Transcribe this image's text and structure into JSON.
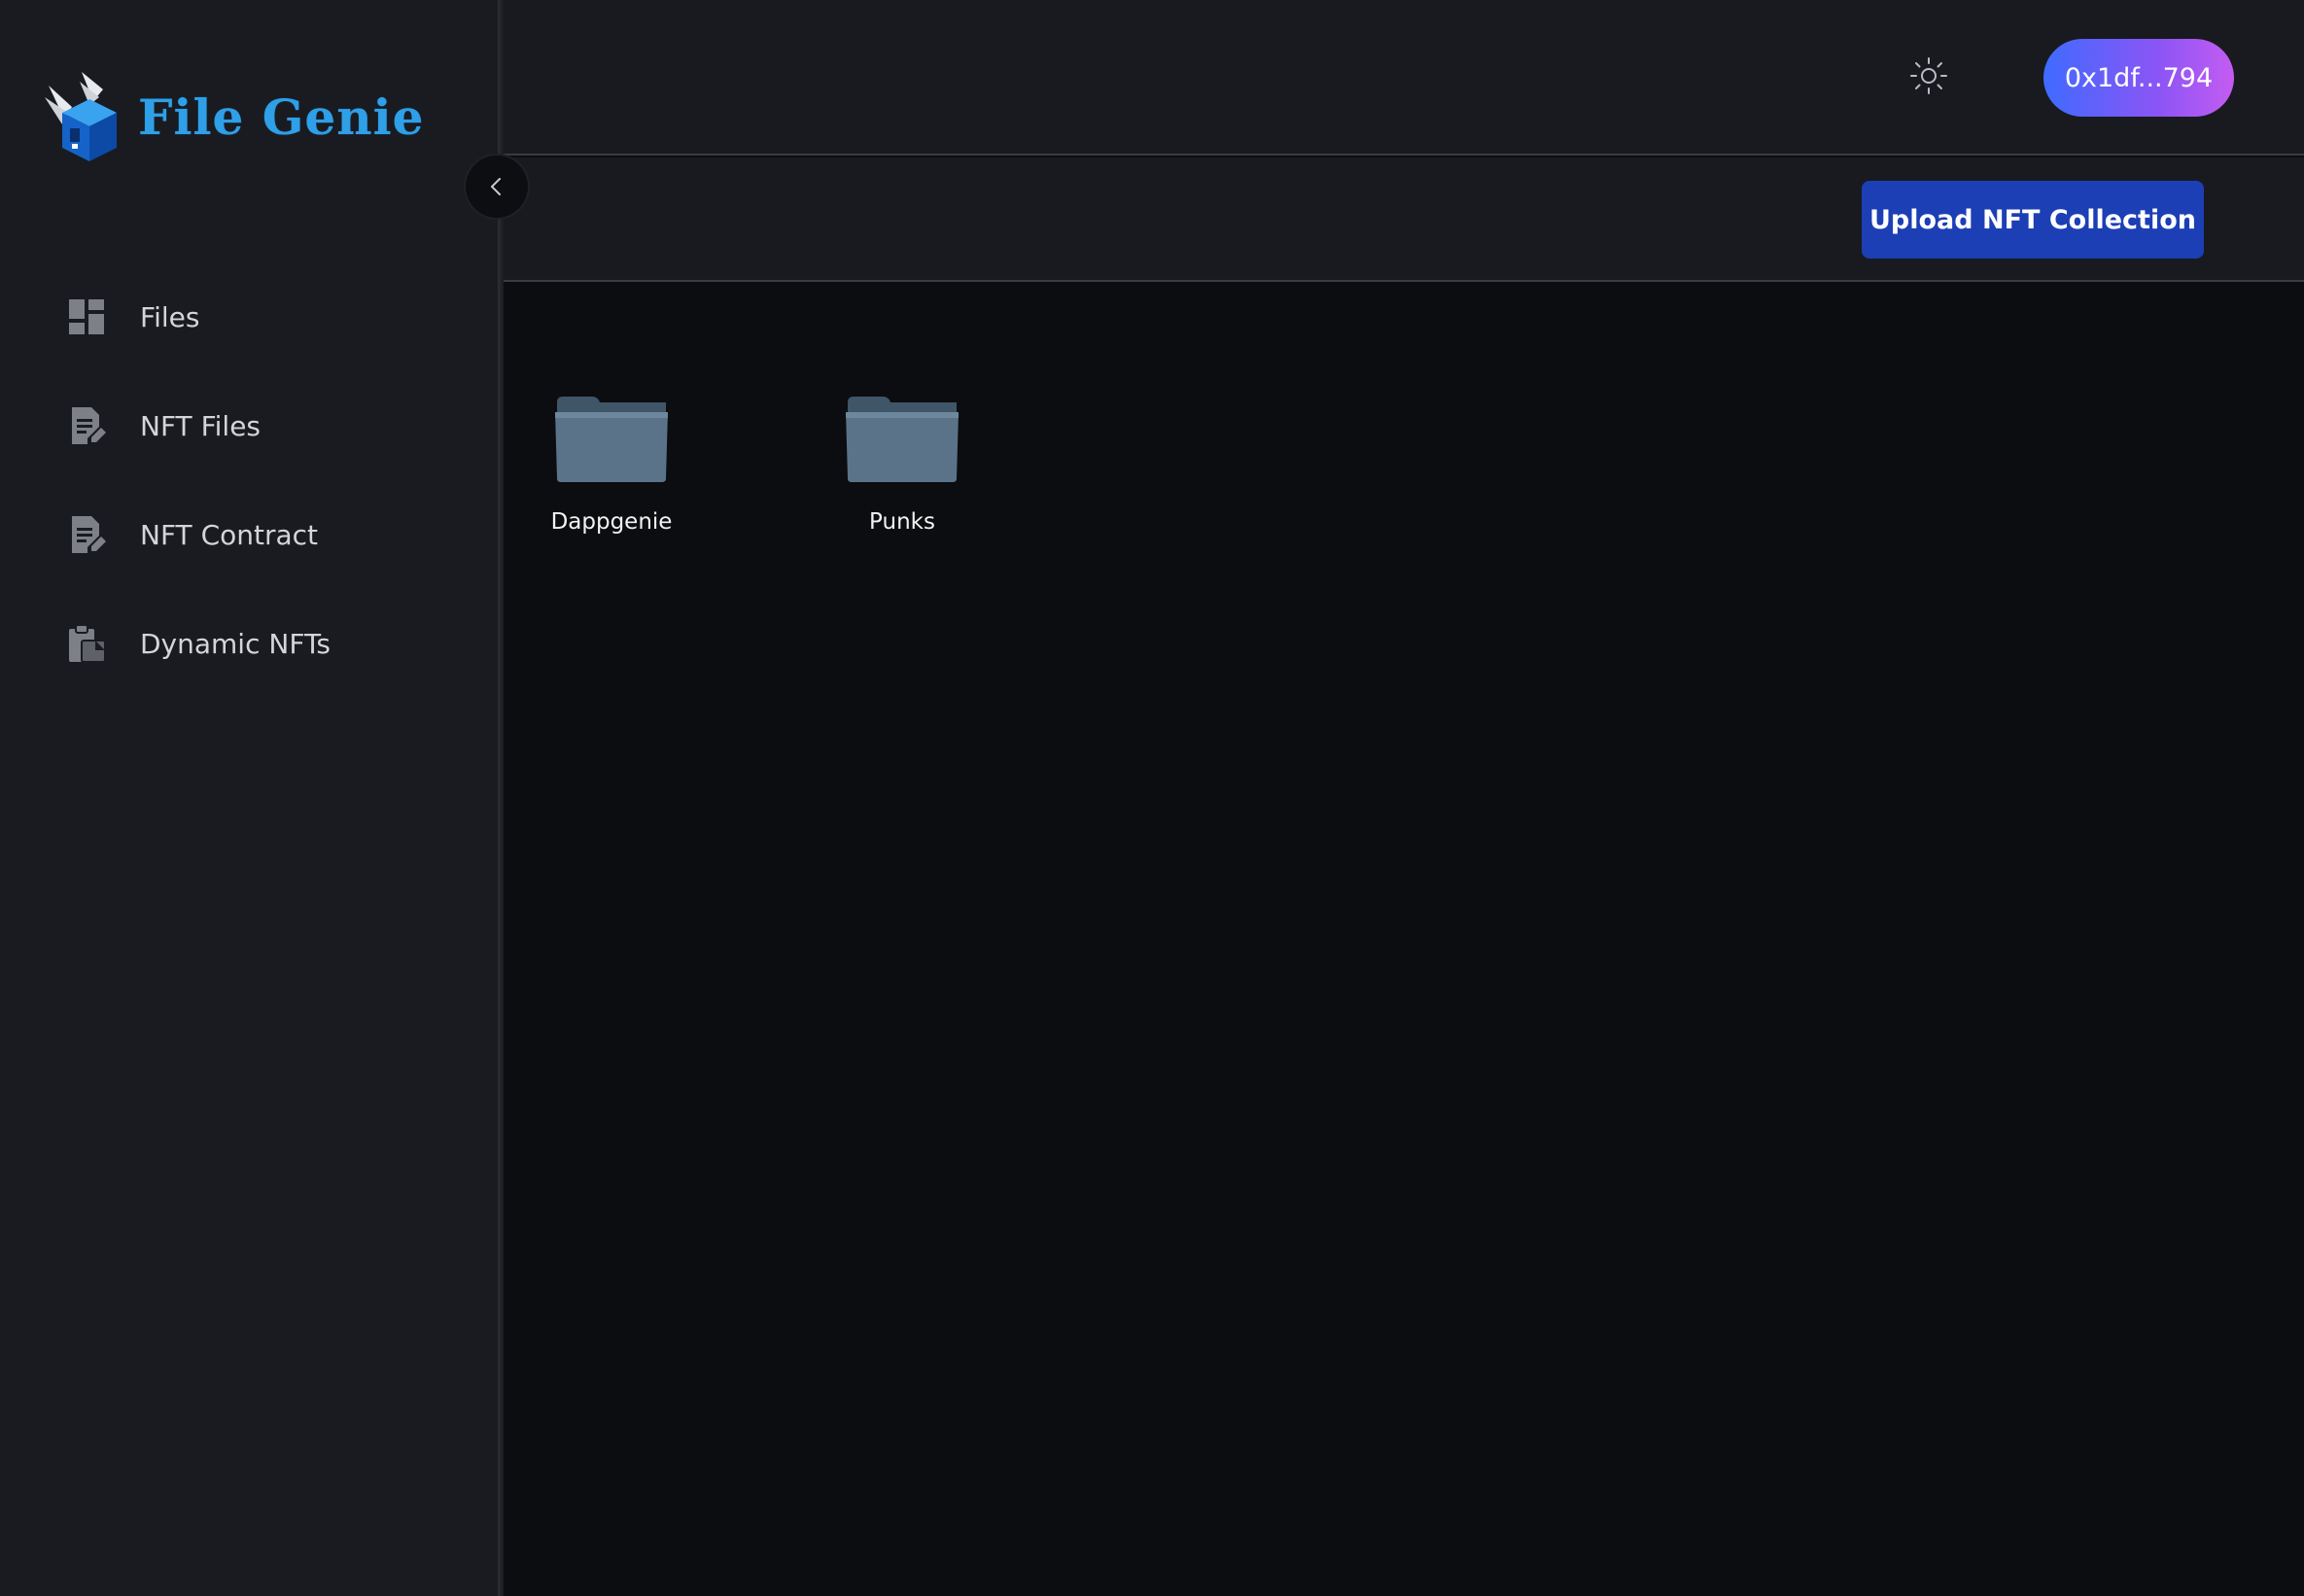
{
  "app": {
    "brand": "File Genie",
    "brand_color": "#2f9fe8"
  },
  "sidebar": {
    "items": [
      {
        "label": "Files",
        "icon": "dashboard-icon"
      },
      {
        "label": "NFT Files",
        "icon": "edit-document-icon"
      },
      {
        "label": "NFT Contract",
        "icon": "edit-document-icon"
      },
      {
        "label": "Dynamic NFTs",
        "icon": "clipboard-icon"
      }
    ],
    "collapse_icon": "chevron-left-icon"
  },
  "header": {
    "theme_icon": "sun-icon",
    "wallet_label": "0x1df...794"
  },
  "actions": {
    "upload_label": "Upload NFT Collection",
    "upload_color": "#1c3fb5"
  },
  "folders": [
    {
      "name": "Dappgenie"
    },
    {
      "name": "Punks"
    }
  ]
}
